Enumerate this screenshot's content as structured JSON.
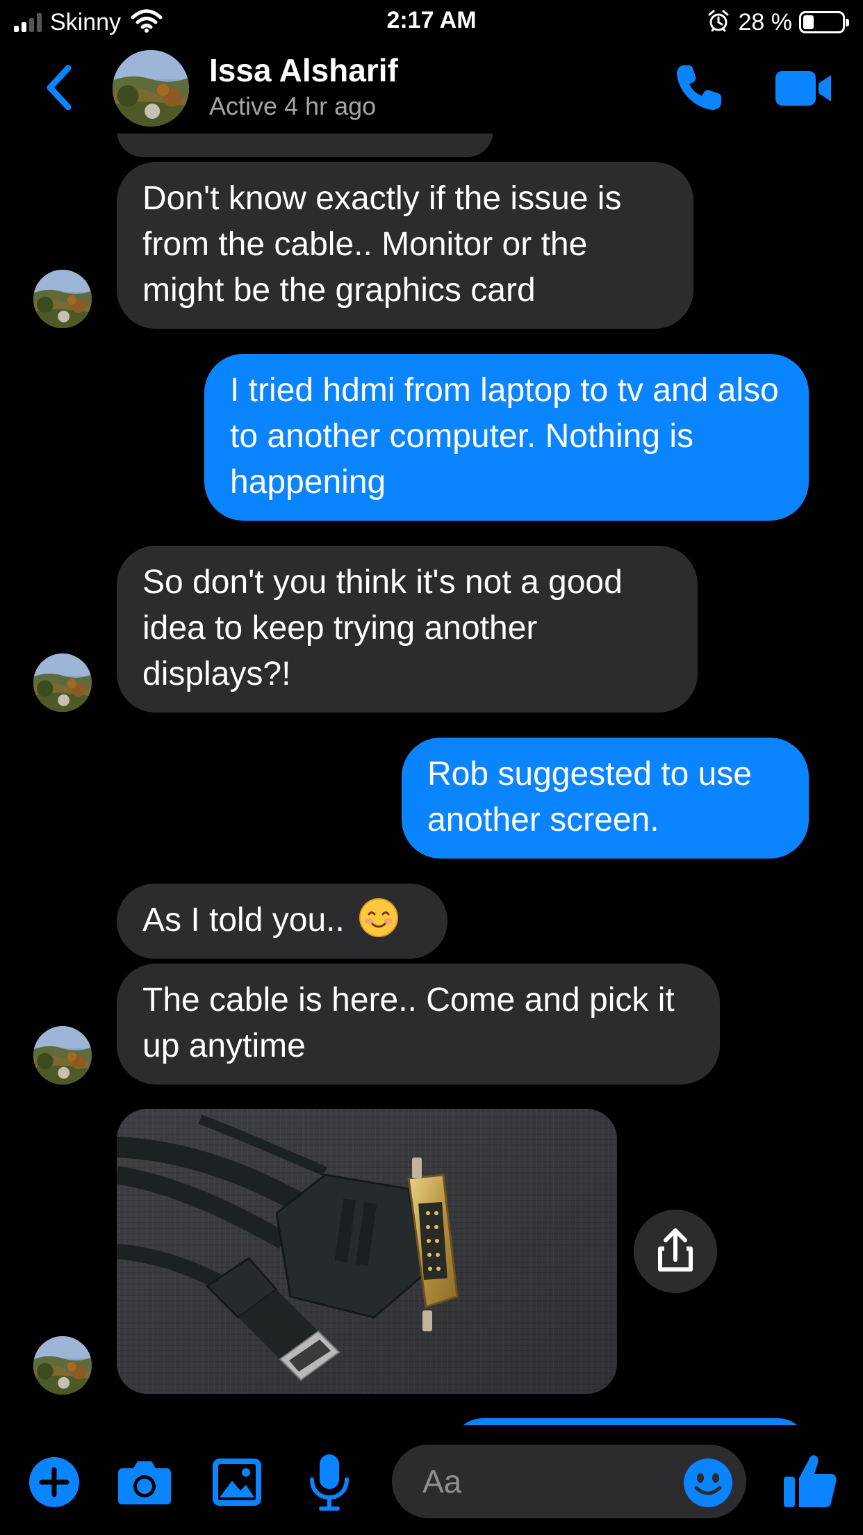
{
  "status_bar": {
    "carrier": "Skinny",
    "time": "2:17 AM",
    "battery_percent": "28 %",
    "battery_level": 0.28
  },
  "header": {
    "contact_name": "Issa Alsharif",
    "contact_status": "Active 4 hr ago",
    "icons": [
      "back-chevron-icon",
      "phone-icon",
      "video-camera-icon"
    ]
  },
  "messages": [
    {
      "direction": "incoming",
      "text": "Don't know exactly if the issue is from the cable..  Monitor or the might be the graphics card"
    },
    {
      "direction": "outgoing",
      "text": "I tried hdmi from laptop to tv and also to another computer. Nothing is happening"
    },
    {
      "direction": "incoming",
      "text": "So don't you think it's not a good idea to keep trying another displays?!"
    },
    {
      "direction": "outgoing",
      "text": "Rob suggested to use another screen."
    },
    {
      "direction": "incoming",
      "text": "As I told you..",
      "emoji": "smiling-face-icon"
    },
    {
      "direction": "incoming",
      "text": "The cable is here..  Come and pick it up anytime"
    },
    {
      "direction": "incoming",
      "attachment": "photo of DVI and HDMI cable"
    }
  ],
  "composer": {
    "placeholder": "Aa",
    "icons": [
      "plus-icon",
      "camera-icon",
      "gallery-icon",
      "microphone-icon",
      "emoji-icon",
      "thumbs-up-icon"
    ]
  },
  "colors": {
    "accent": "#0a84ff",
    "incoming_bubble": "#2c2c2e",
    "background": "#000000",
    "secondary_text": "#a5a5a5"
  }
}
